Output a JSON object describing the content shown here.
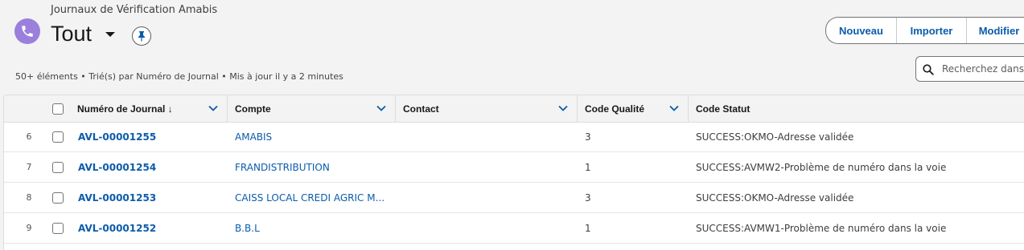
{
  "header": {
    "object_label": "Journaux de Vérification Amabis",
    "list_view_title": "Tout",
    "icons": {
      "object": "phone-icon",
      "caret": "chevron-down-icon",
      "pin": "pin-icon"
    },
    "accent_color": "#9b7fdc"
  },
  "actions": {
    "new_label": "Nouveau",
    "import_label": "Importer",
    "edit_label": "Modifier"
  },
  "meta_text": "50+ éléments • Trié(s) par Numéro de Journal • Mis à jour il y a 2 minutes",
  "search": {
    "placeholder": "Recherchez dans c"
  },
  "table": {
    "columns": [
      {
        "label": "Numéro de Journal ↓"
      },
      {
        "label": "Compte"
      },
      {
        "label": "Contact"
      },
      {
        "label": "Code Qualité"
      },
      {
        "label": "Code Statut"
      }
    ],
    "rows": [
      {
        "index": "6",
        "journal": "AVL-00001255",
        "compte": "AMABIS",
        "contact": "",
        "qualite": "3",
        "statut": "SUCCESS:OKMO-Adresse validée"
      },
      {
        "index": "7",
        "journal": "AVL-00001254",
        "compte": "FRANDISTRIBUTION",
        "contact": "",
        "qualite": "1",
        "statut": "SUCCESS:AVMW2-Problème de numéro dans la voie"
      },
      {
        "index": "8",
        "journal": "AVL-00001253",
        "compte": "CAISS LOCAL CREDI AGRIC M...",
        "contact": "",
        "qualite": "3",
        "statut": "SUCCESS:OKMO-Adresse validée"
      },
      {
        "index": "9",
        "journal": "AVL-00001252",
        "compte": "B.B.L",
        "contact": "",
        "qualite": "1",
        "statut": "SUCCESS:AVMW1-Problème de numéro dans la voie"
      }
    ]
  },
  "link_color": "#0b5cab"
}
